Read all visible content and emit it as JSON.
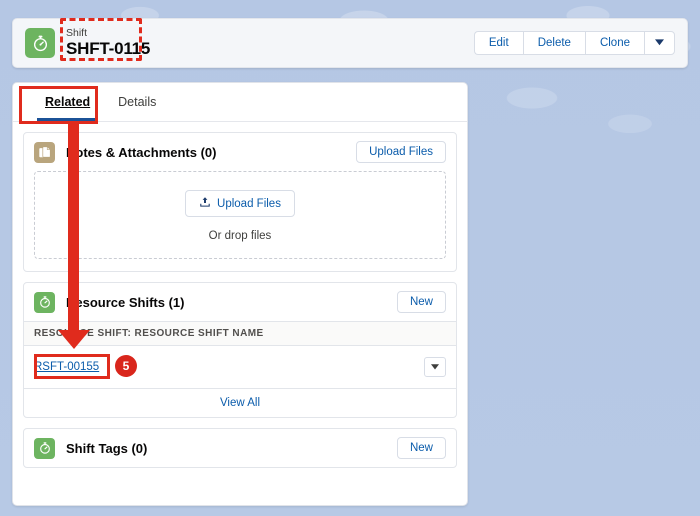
{
  "record_header": {
    "icon": "stopwatch-icon",
    "object_label": "Shift",
    "record_name": "SHFT-0115",
    "actions": [
      {
        "label": "Edit",
        "name": "edit-button"
      },
      {
        "label": "Delete",
        "name": "delete-button"
      },
      {
        "label": "Clone",
        "name": "clone-button"
      }
    ],
    "more_icon": "chevron-down-icon"
  },
  "tabs": [
    {
      "label": "Related",
      "active": true
    },
    {
      "label": "Details",
      "active": false
    }
  ],
  "panels": {
    "notes": {
      "icon": "file-icon",
      "title": "Notes & Attachments (0)",
      "header_button": "Upload Files",
      "dropzone_button": "Upload Files",
      "dropzone_button_icon": "upload-icon",
      "dropzone_text": "Or drop files"
    },
    "resource_shifts": {
      "icon": "stopwatch-icon",
      "title": "Resource Shifts (1)",
      "header_button": "New",
      "column_header": "RESOURCE SHIFT: RESOURCE SHIFT NAME",
      "rows": [
        {
          "link": "RSFT-00155",
          "row_menu_icon": "chevron-down-icon"
        }
      ],
      "footer": "View All"
    },
    "shift_tags": {
      "icon": "stopwatch-icon",
      "title": "Shift Tags (0)",
      "header_button": "New"
    }
  },
  "annotations": {
    "step_badge": "5",
    "highlight_color": "#e02b1d",
    "badge_color": "#d9261c"
  }
}
